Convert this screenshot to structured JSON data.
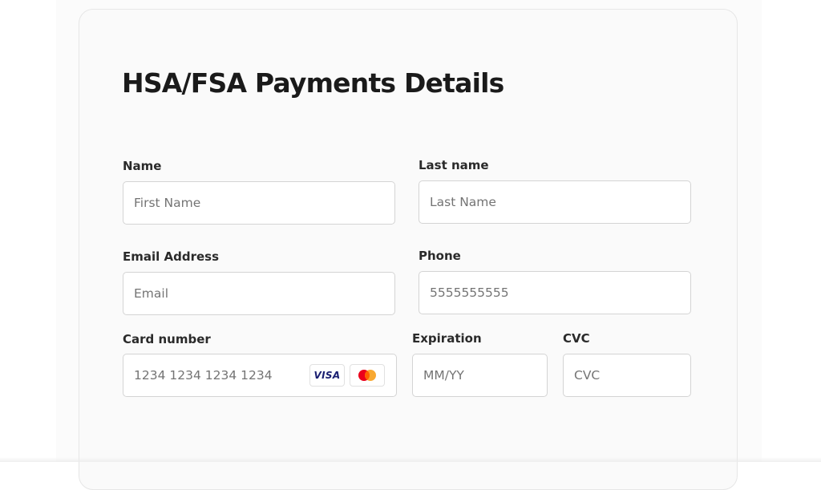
{
  "form": {
    "title": "HSA/FSA Payments Details",
    "first_name": {
      "label": "Name",
      "placeholder": "First Name",
      "value": ""
    },
    "last_name": {
      "label": "Last name",
      "placeholder": "Last Name",
      "value": ""
    },
    "email": {
      "label": "Email Address",
      "placeholder": "Email",
      "value": ""
    },
    "phone": {
      "label": "Phone",
      "placeholder": "5555555555",
      "value": ""
    },
    "card_number": {
      "label": "Card number",
      "placeholder": "1234 1234 1234 1234",
      "value": "",
      "brands": [
        {
          "name": "VISA",
          "icon": "visa-logo-icon",
          "color": "#1a1f71"
        },
        {
          "name": "Mastercard",
          "icon": "mastercard-logo-icon",
          "colors": [
            "#eb001b",
            "#f79e1b"
          ]
        }
      ]
    },
    "expiration": {
      "label": "Expiration",
      "placeholder": "MM/YY",
      "value": ""
    },
    "cvc": {
      "label": "CVC",
      "placeholder": "CVC",
      "value": ""
    }
  },
  "colors": {
    "background": "#ffffff",
    "card": "#fafafa",
    "input_border": "#d4d4d4",
    "title": "#1a1a1a",
    "label": "#2a2a2a",
    "placeholder": "#747474"
  }
}
